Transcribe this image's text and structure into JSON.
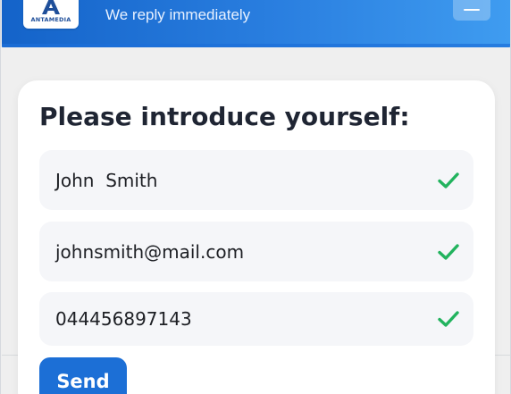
{
  "header": {
    "logo_text": "ANTAMEDIA",
    "title": "",
    "subtitle": "We reply immediately",
    "minimize_icon": "minimize-icon",
    "colors": {
      "gradient_start": "#1463c9",
      "gradient_end": "#3f9cf0"
    }
  },
  "form": {
    "title": "Please introduce yourself:",
    "fields": [
      {
        "value": "John  Smith",
        "status_icon": "check-icon"
      },
      {
        "value": "johnsmith@mail.com",
        "status_icon": "check-icon"
      },
      {
        "value": "044456897143",
        "status_icon": "check-icon"
      }
    ],
    "send_label": "Send",
    "colors": {
      "check": "#22b35e",
      "send_button": "#1c6fd6"
    }
  }
}
